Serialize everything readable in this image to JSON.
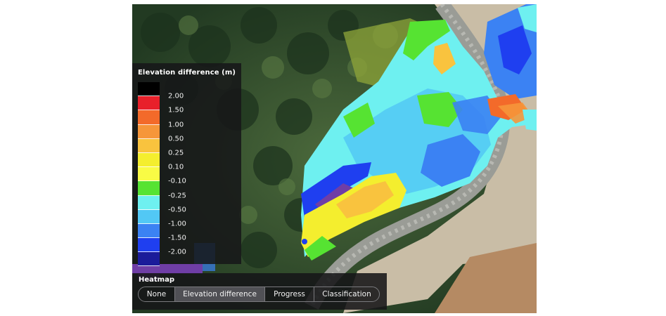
{
  "legend": {
    "title": "Elevation difference (m)",
    "bins": [
      {
        "color": "#000000"
      },
      {
        "color": "#e8202a",
        "label": "2.00"
      },
      {
        "color": "#f36a2a",
        "label": "1.50"
      },
      {
        "color": "#f6963a",
        "label": "1.00"
      },
      {
        "color": "#f9c33e",
        "label": "0.50"
      },
      {
        "color": "#f4ee2e",
        "label": "0.25"
      },
      {
        "color": "#f9fb45",
        "label": "0.10"
      },
      {
        "color": "#56e332",
        "label": "-0.10"
      },
      {
        "color": "#6ef0f0",
        "label": "-0.25"
      },
      {
        "color": "#52c8f5",
        "label": "-0.50"
      },
      {
        "color": "#3b82f3",
        "label": "-1.00"
      },
      {
        "color": "#1f3ff0",
        "label": "-1.50"
      },
      {
        "color": "#1b1b9a",
        "label": "-2.00"
      },
      {
        "color": "#6f3ea6"
      }
    ]
  },
  "heatmap": {
    "label": "Heatmap",
    "options": [
      "None",
      "Elevation difference",
      "Progress",
      "Classification"
    ],
    "selected": "Elevation difference"
  },
  "colors": {
    "vegetation": "#2f4a2c",
    "road": "#9a9c96",
    "bare_soil": "#c9bda6",
    "panel_bg": "#161618"
  }
}
